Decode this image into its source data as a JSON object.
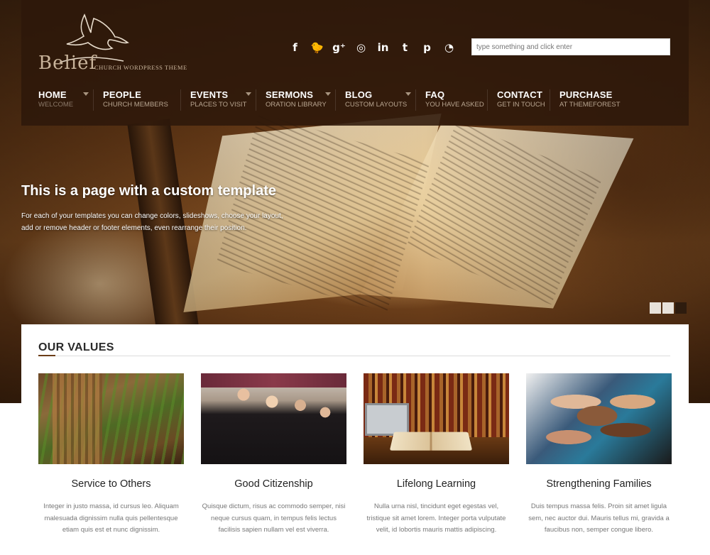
{
  "logo": {
    "wordmark": "Belief",
    "tagline": "CHURCH WORDPRESS THEME",
    "icon": "dove-icon"
  },
  "social": [
    {
      "name": "facebook-icon",
      "glyph": "f"
    },
    {
      "name": "twitter-icon",
      "glyph": "🐦"
    },
    {
      "name": "google-plus-icon",
      "glyph": "g⁺"
    },
    {
      "name": "dribbble-icon",
      "glyph": "◎"
    },
    {
      "name": "linkedin-icon",
      "glyph": "in"
    },
    {
      "name": "tumblr-icon",
      "glyph": "t"
    },
    {
      "name": "pinterest-icon",
      "glyph": "p"
    },
    {
      "name": "rss-icon",
      "glyph": "◔"
    }
  ],
  "search": {
    "placeholder": "type something and click enter"
  },
  "nav": {
    "home": {
      "label": "HOME",
      "sub": "WELCOME"
    },
    "people": {
      "label": "PEOPLE",
      "sub": "CHURCH MEMBERS"
    },
    "events": {
      "label": "EVENTS",
      "sub": "PLACES TO VISIT"
    },
    "sermons": {
      "label": "SERMONS",
      "sub": "ORATION LIBRARY"
    },
    "blog": {
      "label": "BLOG",
      "sub": "CUSTOM LAYOUTS"
    },
    "faq": {
      "label": "FAQ",
      "sub": "YOU HAVE ASKED"
    },
    "contact": {
      "label": "CONTACT",
      "sub": "GET IN TOUCH"
    },
    "purchase": {
      "label": "PURCHASE",
      "sub": "AT THEMEFOREST"
    }
  },
  "hero": {
    "title": "This is a page with a custom template",
    "description": "For each of your templates you can change colors, slideshows, choose your layout, add or remove header or footer elements, even rearrange their position."
  },
  "values": {
    "heading": "OUR VALUES",
    "cards": [
      {
        "title": "Service to Others",
        "text": "Integer in justo massa, id cursus leo. Aliquam malesuada dignissim nulla quis pellentesque etiam quis est et nunc dignissim."
      },
      {
        "title": "Good Citizenship",
        "text": "Quisque dictum, risus ac commodo semper, nisi neque cursus quam, in tempus felis lectus facilisis sapien nullam vel est viverra."
      },
      {
        "title": "Lifelong Learning",
        "text": "Nulla urna nisl, tincidunt eget egestas vel, tristique sit amet lorem. Integer porta vulputate velit, id lobortis mauris mattis adipiscing."
      },
      {
        "title": "Strengthening Families",
        "text": "Duis tempus massa felis. Proin sit amet ligula sem, nec auctor dui. Mauris tellus mi, gravida a faucibus non, semper congue libero."
      }
    ]
  },
  "colors": {
    "header_bg": "#2d180a",
    "accent": "#6b3d18",
    "nav_sub": "#b8a590"
  }
}
